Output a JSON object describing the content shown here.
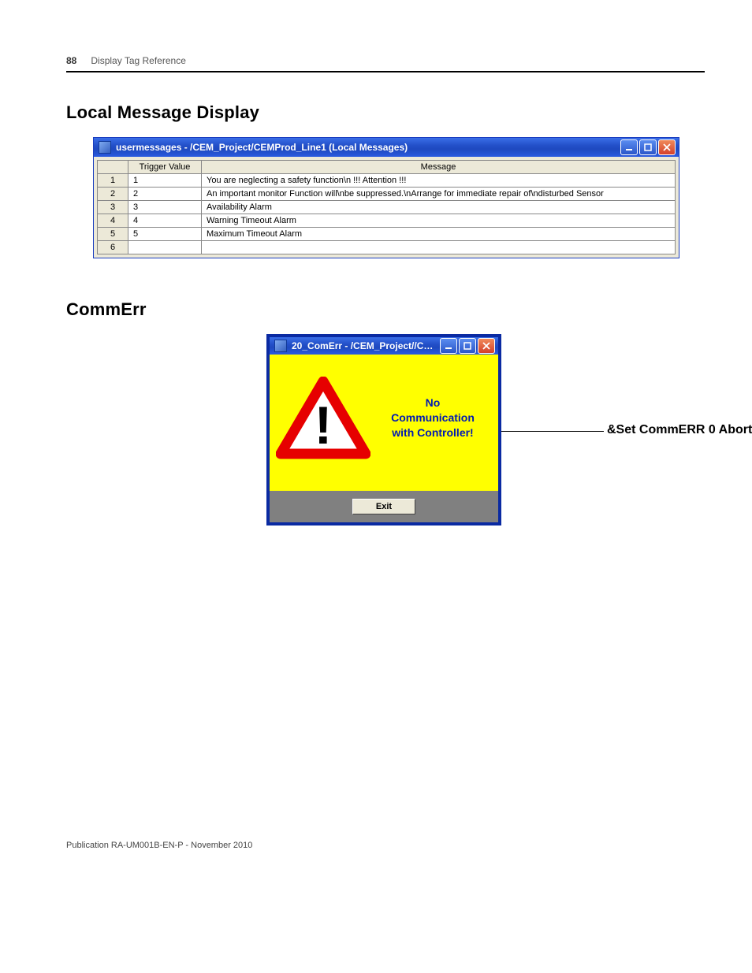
{
  "page": {
    "number": "88",
    "chapter": "Display Tag Reference",
    "footer": "Publication RA-UM001B-EN-P - November 2010"
  },
  "section1": {
    "heading": "Local Message Display",
    "window_title": "usermessages - /CEM_Project/CEMProd_Line1 (Local Messages)",
    "columns": {
      "row": "",
      "trigger": "Trigger Value",
      "message": "Message"
    },
    "rows": [
      {
        "n": "1",
        "trigger": "1",
        "message": "You are neglecting a safety function\\n !!! Attention !!!"
      },
      {
        "n": "2",
        "trigger": "2",
        "message": "An important monitor Function will\\nbe suppressed.\\nArrange for immediate repair of\\ndisturbed Sensor"
      },
      {
        "n": "3",
        "trigger": "3",
        "message": "Availability Alarm"
      },
      {
        "n": "4",
        "trigger": "4",
        "message": "Warning Timeout Alarm"
      },
      {
        "n": "5",
        "trigger": "5",
        "message": "Maximum Timeout Alarm"
      },
      {
        "n": "6",
        "trigger": "",
        "message": ""
      }
    ]
  },
  "section2": {
    "heading": "CommErr",
    "window_title": "20_ComErr - /CEM_Project//C…",
    "message_line1": "No",
    "message_line2": "Communication",
    "message_line3": "with Controller!",
    "exit_label": "Exit",
    "callout": "&Set CommERR 0 Abort"
  }
}
